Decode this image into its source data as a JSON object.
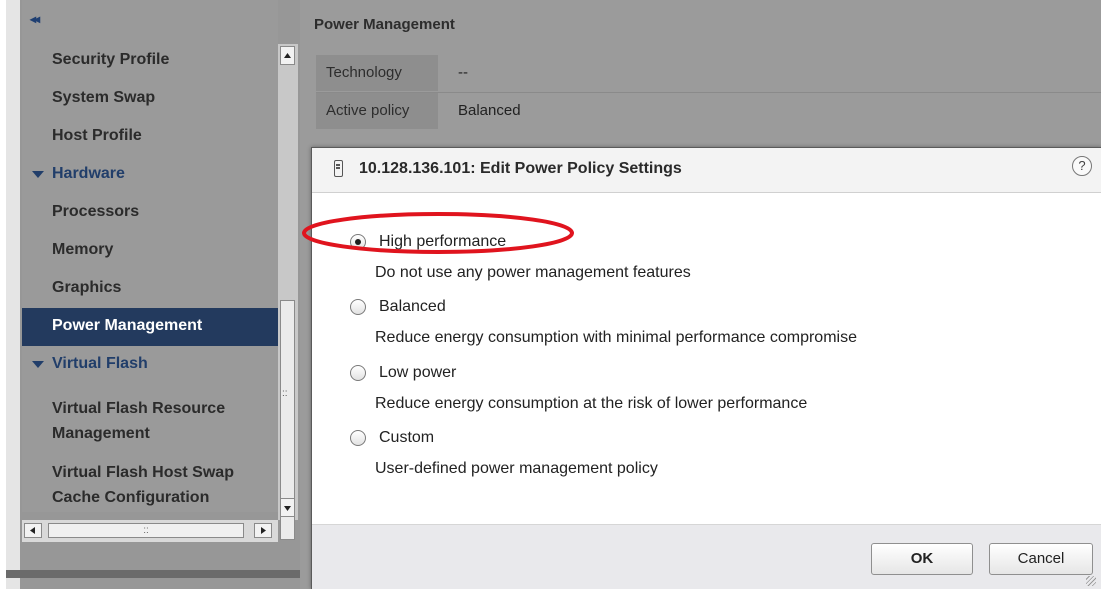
{
  "nav": {
    "collapse_label": "◂◂",
    "items": [
      {
        "label": "Security Profile",
        "type": "item"
      },
      {
        "label": "System Swap",
        "type": "item"
      },
      {
        "label": "Host Profile",
        "type": "item"
      },
      {
        "label": "Hardware",
        "type": "group"
      },
      {
        "label": "Processors",
        "type": "item"
      },
      {
        "label": "Memory",
        "type": "item"
      },
      {
        "label": "Graphics",
        "type": "item"
      },
      {
        "label": "Power Management",
        "type": "item",
        "active": true
      },
      {
        "label": "Virtual Flash",
        "type": "group"
      },
      {
        "label": "Virtual Flash Resource Management",
        "type": "item"
      },
      {
        "label": "Virtual Flash Host Swap Cache Configuration",
        "type": "item"
      }
    ],
    "scroll_grip": "::"
  },
  "main": {
    "title": "Power Management",
    "properties": [
      {
        "key": "Technology",
        "value": "--"
      },
      {
        "key": "Active policy",
        "value": "Balanced"
      }
    ]
  },
  "dialog": {
    "title": "10.128.136.101: Edit Power Policy Settings",
    "help": "?",
    "options": [
      {
        "label": "High performance",
        "desc": "Do not use any power management features",
        "checked": true
      },
      {
        "label": "Balanced",
        "desc": "Reduce energy consumption with minimal performance compromise",
        "checked": false
      },
      {
        "label": "Low power",
        "desc": "Reduce energy consumption at the risk of lower performance",
        "checked": false
      },
      {
        "label": "Custom",
        "desc": "User-defined power management policy",
        "checked": false
      }
    ],
    "ok_label": "OK",
    "cancel_label": "Cancel"
  },
  "colors": {
    "nav_active": "#233a5e",
    "highlight_ellipse": "#e0141e"
  }
}
